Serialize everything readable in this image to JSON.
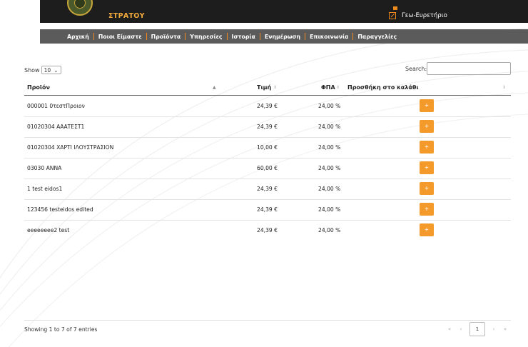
{
  "header": {
    "brand": "ΣΤΡΑΤΟΥ",
    "geo_link": "Γεω-Ευρετήριο"
  },
  "nav": {
    "items": [
      "Αρχική",
      "Ποιοι Είμαστε",
      "Προϊόντα",
      "Υπηρεσίες",
      "Ιστορία",
      "Ενημέρωση",
      "Επικοινωνία",
      "Παραγγελίες"
    ]
  },
  "table_controls": {
    "show_label": "Show",
    "page_size": "10",
    "search_label": "Search:"
  },
  "table": {
    "columns": [
      "Προϊόν",
      "Τιμή",
      "ΦΠΑ",
      "Προσθήκη στο καλάθι"
    ],
    "add_label": "+",
    "rows": [
      {
        "product": "000001 0τεστΠροιον",
        "price": "24,39 €",
        "vat": "24,00 %"
      },
      {
        "product": "01020304 ΑΑΑΤΕΣΤ1",
        "price": "24,39 €",
        "vat": "24,00 %"
      },
      {
        "product": "01020304 ΧΑΡΤΙ ΙΛΟΥΣΤΡΑΣΙΟΝ",
        "price": "10,00 €",
        "vat": "24,00 %"
      },
      {
        "product": "03030 ΑΝΝΑ",
        "price": "60,00 €",
        "vat": "24,00 %"
      },
      {
        "product": "1 test eidos1",
        "price": "24,39 €",
        "vat": "24,00 %"
      },
      {
        "product": "123456 testeidos edited",
        "price": "24,39 €",
        "vat": "24,00 %"
      },
      {
        "product": "eeeeeeee2 test",
        "price": "24,39 €",
        "vat": "24,00 %"
      }
    ]
  },
  "footer": {
    "info": "Showing 1 to 7 of 7 entries",
    "first": "«",
    "prev": "‹",
    "current_page": "1",
    "next": "›",
    "last": "»"
  },
  "colors": {
    "accent": "#f39a2a",
    "topbar": "#1d1d1d",
    "navbar": "#5b5b5b"
  }
}
